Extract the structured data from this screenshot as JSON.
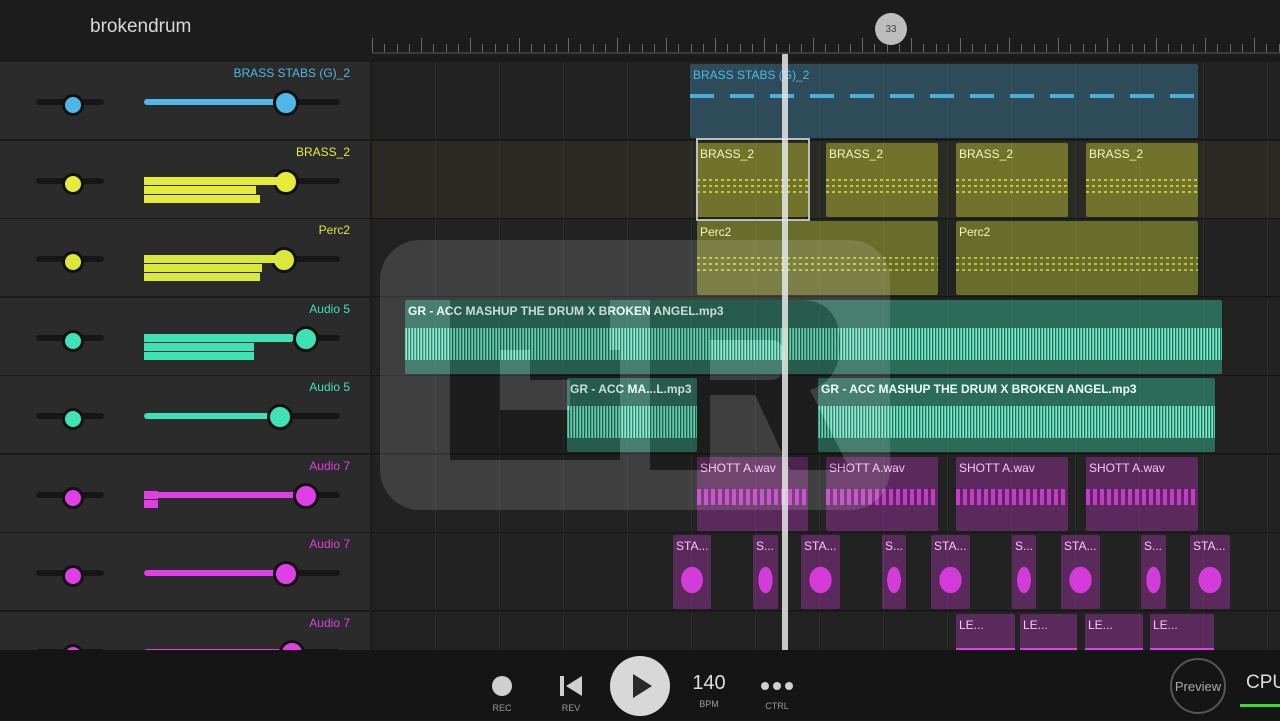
{
  "project": {
    "title": "brokendrum"
  },
  "ruler": {
    "marker_label": "33"
  },
  "tracks": [
    {
      "name": "BRASS STABS (G)_2",
      "color": "#4fb8e8",
      "volume_level": 0.72,
      "clips": [
        {
          "label": "BRASS STABS (G)_2"
        }
      ]
    },
    {
      "name": "BRASS_2",
      "color": "#e6ec3a",
      "volume_level": 0.72,
      "clips": [
        {
          "label": "BRASS_2"
        },
        {
          "label": "BRASS_2"
        },
        {
          "label": "BRASS_2"
        },
        {
          "label": "BRASS_2"
        }
      ]
    },
    {
      "name": "Perc2",
      "color": "#d9e83a",
      "volume_level": 0.71,
      "clips": [
        {
          "label": "Perc2"
        },
        {
          "label": "Perc2"
        }
      ]
    },
    {
      "name": "Audio 5",
      "color": "#3ee2b4",
      "volume_level": 0.82,
      "clips": [
        {
          "label": "GR - ACC MASHUP THE DRUM X BROKEN ANGEL.mp3"
        }
      ]
    },
    {
      "name": "Audio 5",
      "color": "#3ee2b4",
      "volume_level": 0.69,
      "clips": [
        {
          "label": "GR - ACC MA...L.mp3"
        },
        {
          "label": "GR - ACC MASHUP THE DRUM X BROKEN ANGEL.mp3"
        }
      ]
    },
    {
      "name": "Audio 7",
      "color": "#e03ee6",
      "volume_level": 0.82,
      "clips": [
        {
          "label": "SHOTT A.wav"
        },
        {
          "label": "SHOTT A.wav"
        },
        {
          "label": "SHOTT A.wav"
        },
        {
          "label": "SHOTT A.wav"
        }
      ]
    },
    {
      "name": "Audio 7",
      "color": "#e03ee6",
      "volume_level": 0.72,
      "clips": [
        {
          "label": "STA..."
        },
        {
          "label": "S..."
        },
        {
          "label": "STA..."
        },
        {
          "label": "S..."
        },
        {
          "label": "STA..."
        },
        {
          "label": "S..."
        },
        {
          "label": "STA..."
        },
        {
          "label": "S..."
        },
        {
          "label": "STA..."
        }
      ]
    },
    {
      "name": "Audio 7",
      "color": "#e03ee6",
      "volume_level": 0.75,
      "clips": [
        {
          "label": "LE..."
        },
        {
          "label": "LE..."
        },
        {
          "label": "LE..."
        },
        {
          "label": "LE..."
        }
      ]
    }
  ],
  "transport": {
    "rec_label": "REC",
    "rev_label": "REV",
    "bpm_value": "140",
    "bpm_label": "BPM",
    "ctrl_label": "CTRL",
    "preview_label": "Preview",
    "cpu_label": "CPU"
  },
  "icons": [
    "record-icon",
    "rewind-icon",
    "play-icon",
    "more-dots-icon"
  ]
}
